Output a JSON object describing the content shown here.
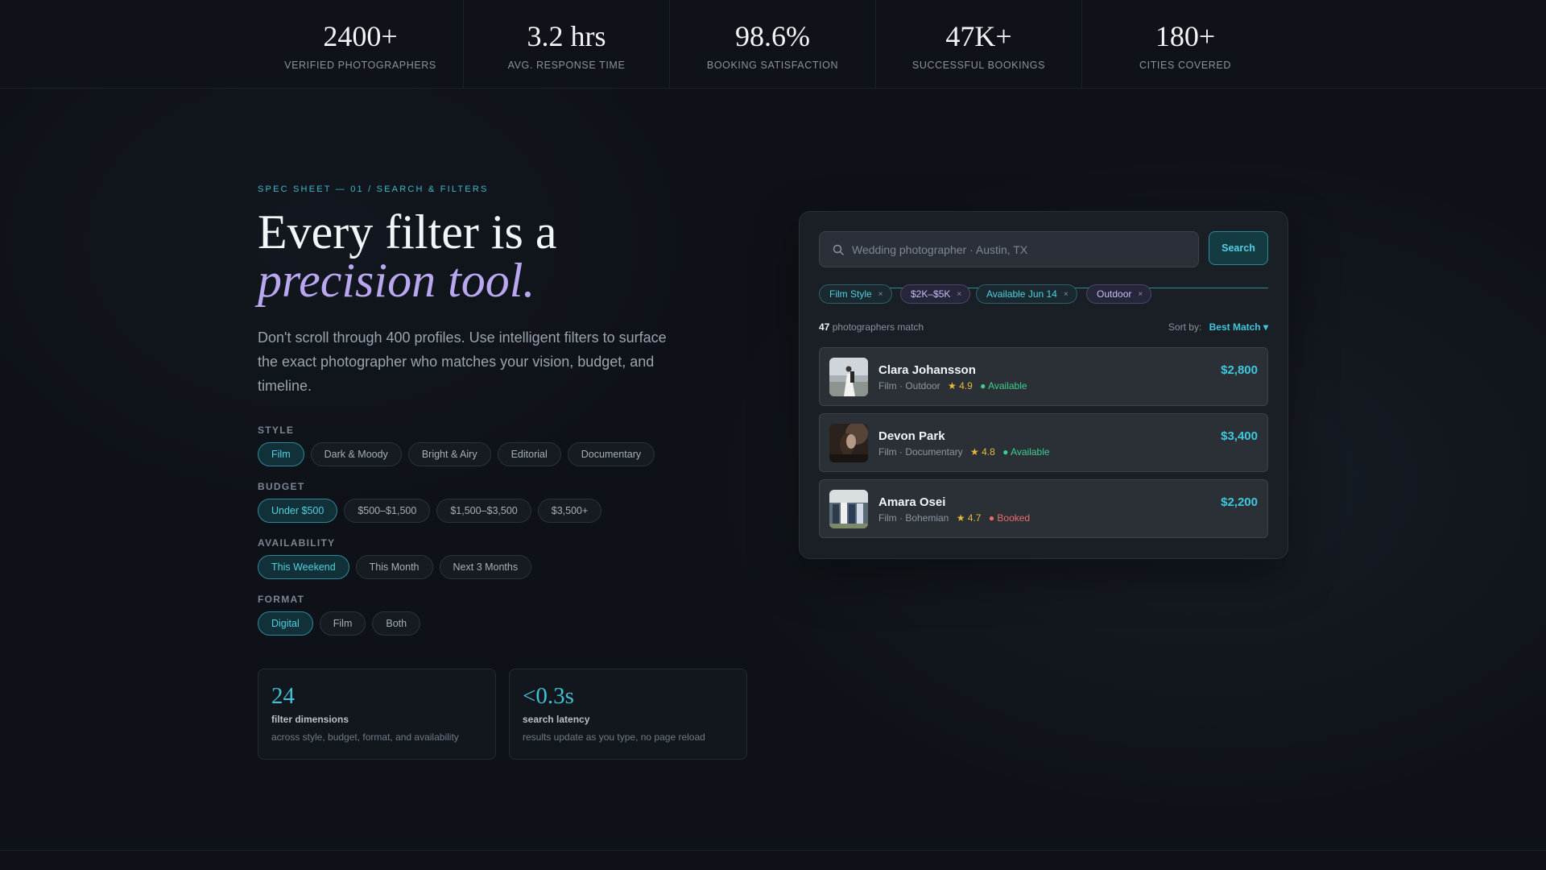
{
  "stats": [
    {
      "value": "2400+",
      "label": "VERIFIED PHOTOGRAPHERS"
    },
    {
      "value": "3.2 hrs",
      "label": "AVG. RESPONSE TIME"
    },
    {
      "value": "98.6%",
      "label": "BOOKING SATISFACTION"
    },
    {
      "value": "47K+",
      "label": "SUCCESSFUL BOOKINGS"
    },
    {
      "value": "180+",
      "label": "CITIES COVERED"
    }
  ],
  "hero": {
    "eyebrow": "SPEC SHEET — 01 / SEARCH & FILTERS",
    "headline_line1": "Every filter is a",
    "headline_line2": "precision tool.",
    "lede": "Don't scroll through 400 profiles. Use intelligent filters to surface the exact photographer who matches your vision, budget, and timeline."
  },
  "filters": {
    "style": {
      "label": "STYLE",
      "options": [
        "Film",
        "Dark & Moody",
        "Bright & Airy",
        "Editorial",
        "Documentary"
      ],
      "selected": "Film"
    },
    "budget": {
      "label": "BUDGET",
      "options": [
        "Under $500",
        "$500–$1,500",
        "$1,500–$3,500",
        "$3,500+"
      ],
      "selected": "Under $500"
    },
    "availability": {
      "label": "AVAILABILITY",
      "options": [
        "This Weekend",
        "This Month",
        "Next 3 Months"
      ],
      "selected": "This Weekend"
    },
    "format": {
      "label": "FORMAT",
      "options": [
        "Digital",
        "Film",
        "Both"
      ],
      "selected": "Digital"
    }
  },
  "metrics": [
    {
      "value": "24",
      "title": "filter dimensions",
      "desc": "across style, budget, format, and availability"
    },
    {
      "value": "<0.3s",
      "title": "search latency",
      "desc": "results update as you type, no page reload"
    }
  ],
  "search": {
    "placeholder": "Wedding photographer · Austin, TX",
    "button": "Search",
    "tags": [
      {
        "label": "Film Style",
        "remove": "×",
        "tone": "cyan"
      },
      {
        "label": "$2K–$5K",
        "remove": "×",
        "tone": "violet"
      },
      {
        "label": "Available Jun 14",
        "remove": "×",
        "tone": "cyan"
      },
      {
        "label": "Outdoor",
        "remove": "×",
        "tone": "violet"
      }
    ],
    "count": "47",
    "count_suffix": "photographers match",
    "sort_label": "Sort by:",
    "sort_value": "Best Match ▾"
  },
  "results": [
    {
      "name": "Clara Johansson",
      "tags": "Film · Outdoor",
      "rating": "★ 4.9",
      "status": "● Available",
      "status_type": "available",
      "price": "$2,800"
    },
    {
      "name": "Devon Park",
      "tags": "Film · Documentary",
      "rating": "★ 4.8",
      "status": "● Available",
      "status_type": "available",
      "price": "$3,400"
    },
    {
      "name": "Amara Osei",
      "tags": "Film · Bohemian",
      "rating": "★ 4.7",
      "status": "● Booked",
      "status_type": "booked",
      "price": "$2,200"
    }
  ],
  "colors": {
    "accent": "#3fc8dc",
    "headline_accent": "#b9a7f0",
    "available": "#3dcf8e",
    "booked": "#ef6b6b",
    "rating": "#e8b93a"
  }
}
